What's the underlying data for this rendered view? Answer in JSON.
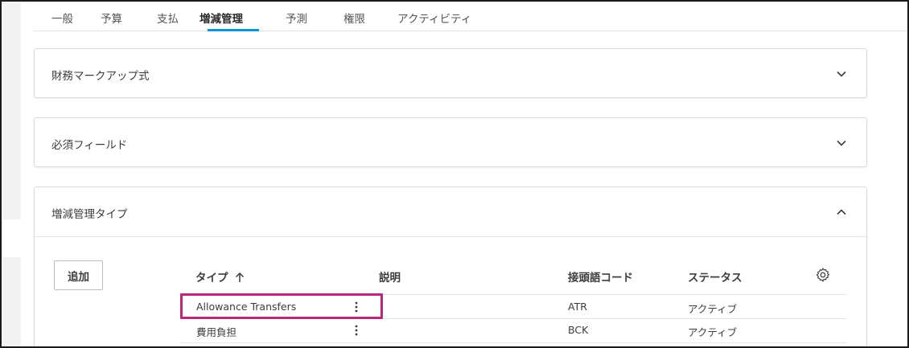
{
  "tabs": [
    {
      "label": "一般"
    },
    {
      "label": "予算"
    },
    {
      "label": "支払"
    },
    {
      "label": "増減管理"
    },
    {
      "label": "予測"
    },
    {
      "label": "権限"
    },
    {
      "label": "アクティビティ"
    }
  ],
  "active_tab": "増減管理",
  "panels": {
    "markup": {
      "title": "財務マークアップ式",
      "state": "collapsed"
    },
    "required": {
      "title": "必須フィールド",
      "state": "collapsed"
    },
    "change_types": {
      "title": "増減管理タイプ",
      "state": "expanded"
    }
  },
  "table": {
    "add_label": "追加",
    "headers": {
      "type": "タイプ",
      "description": "説明",
      "prefix": "接頭語コード",
      "status": "ステータス"
    },
    "sort": {
      "column": "type",
      "direction": "ascending"
    },
    "rows": [
      {
        "type": "Allowance Transfers",
        "description": "",
        "prefix": "ATR",
        "status": "アクティブ"
      },
      {
        "type": "費用負担",
        "description": "",
        "prefix": "BCK",
        "status": "アクティブ"
      }
    ]
  },
  "icons": {
    "collapse": "chevron-down-icon",
    "expand": "chevron-up-icon",
    "settings": "gear-icon",
    "row_menu": "kebab-menu-icon",
    "sort": "arrow-up-icon"
  },
  "colors": {
    "accent": "#0696d7",
    "highlight": "#b8287a"
  }
}
